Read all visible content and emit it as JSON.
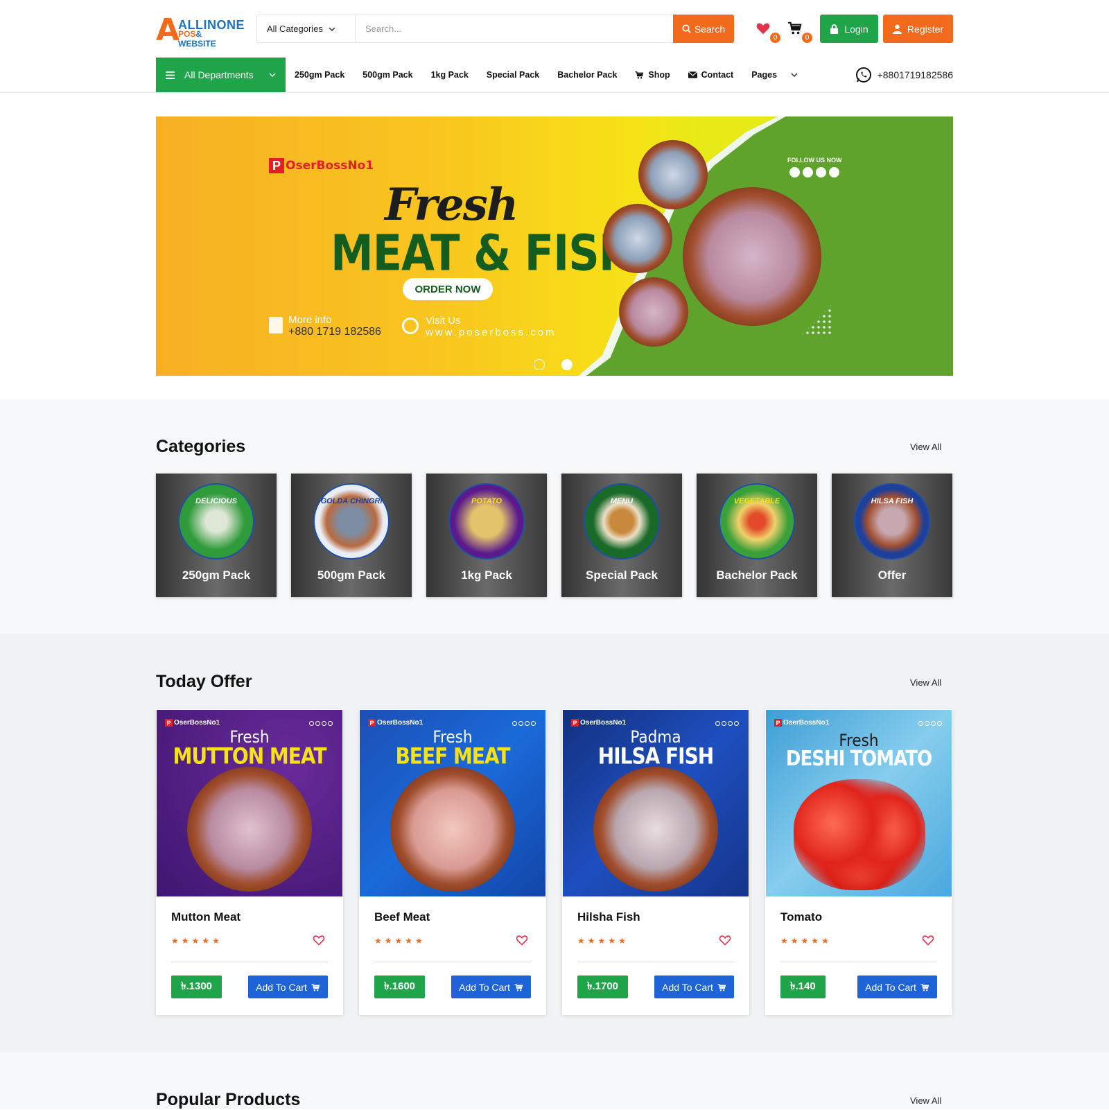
{
  "header": {
    "logo_a": "A",
    "logo_line1": "ALLINONE",
    "logo_line2_a": "POS",
    "logo_line2_b": "& WEBSITE",
    "category_select": "All Categories",
    "search_placeholder": "Search...",
    "search_button": "Search",
    "wishlist_count": "0",
    "cart_count": "0",
    "login": "Login",
    "register": "Register"
  },
  "nav": {
    "departments": "All Departments",
    "items": [
      "250gm Pack",
      "500gm Pack",
      "1kg Pack",
      "Special Pack",
      "Bachelor Pack",
      "Shop",
      "Contact",
      "Pages"
    ],
    "phone": "+8801719182586"
  },
  "banner": {
    "brand_p": "P",
    "brand_text": "OserBossNo1",
    "script_title": "Fresh",
    "title": "MEAT & FISH",
    "cta": "ORDER NOW",
    "more_info_label": "More info",
    "more_info_phone": "+880 1719 182586",
    "visit_label": "Visit Us",
    "visit_url": "www.poserboss.com",
    "follow_label": "FOLLOW US NOW"
  },
  "categories": {
    "title": "Categories",
    "view_all": "View All",
    "items": [
      {
        "label": "250gm Pack",
        "tag": "DELICIOUS",
        "bg": "#2f9a3a"
      },
      {
        "label": "500gm Pack",
        "tag": "GOLDA CHINGRI",
        "bg": "#e9eef6"
      },
      {
        "label": "1kg Pack",
        "tag": "POTATO",
        "bg": "#5a1a8c"
      },
      {
        "label": "Special Pack",
        "tag": "MENU",
        "bg": "#1a6b2a"
      },
      {
        "label": "Bachelor Pack",
        "tag": "VEGETABLE",
        "bg": "#3aa03a"
      },
      {
        "label": "Offer",
        "tag": "HILSA FISH",
        "bg": "#1e3f9a"
      }
    ]
  },
  "offer": {
    "title": "Today Offer",
    "view_all": "View All",
    "brand_p": "P",
    "brand_text": "OserBossNo1",
    "products": [
      {
        "name": "Mutton Meat",
        "headline1": "Fresh",
        "headline2": "MUTTON MEAT",
        "price": "৳.1300",
        "cta": "Add To Cart",
        "bg": "#4a1f7a",
        "headline_color": "#f6e21b"
      },
      {
        "name": "Beef Meat",
        "headline1": "Fresh",
        "headline2": "BEEF MEAT",
        "price": "৳.1600",
        "cta": "Add To Cart",
        "bg": "#1a58c9",
        "headline_color": "#f6e21b"
      },
      {
        "name": "Hilsha Fish",
        "headline1": "Padma",
        "headline2": "HILSA FISH",
        "price": "৳.1700",
        "cta": "Add To Cart",
        "bg": "#1a3fa0",
        "headline_color": "#ffffff"
      },
      {
        "name": "Tomato",
        "headline1": "Fresh",
        "headline2": "DESHI TOMATO",
        "price": "৳.140",
        "cta": "Add To Cart",
        "bg": "#5fb6e2",
        "headline_color": "#ffffff"
      }
    ]
  },
  "popular": {
    "title": "Popular Products",
    "view_all": "View All"
  }
}
